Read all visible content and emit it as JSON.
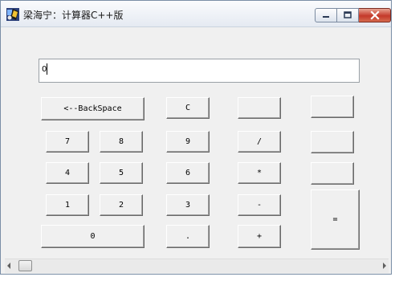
{
  "window": {
    "title": "梁海宁：计算器C++版",
    "title_icon": "calculator-app-icon",
    "controls": {
      "minimize_icon": "minimize-icon",
      "maximize_icon": "maximize-icon",
      "close_icon": "close-icon"
    }
  },
  "display": {
    "value": "0"
  },
  "buttons": {
    "backspace": "<--BackSpace",
    "clear": "C",
    "blank_row1_col4": "",
    "blank_row1_col5": "",
    "n7": "7",
    "n8": "8",
    "n9": "9",
    "divide": "/",
    "blank_row2_col5": "",
    "n4": "4",
    "n5": "5",
    "n6": "6",
    "multiply": "*",
    "blank_row3_col5": "",
    "n1": "1",
    "n2": "2",
    "n3": "3",
    "subtract": "-",
    "equals": "=",
    "n0": "0",
    "decimal": ".",
    "add": "+"
  },
  "scrollbar": {
    "left_icon": "scroll-left-icon",
    "right_icon": "scroll-right-icon"
  },
  "colors": {
    "close_button": "#c4392a",
    "window_bg": "#f0f0f0",
    "title_bar": "#e5eaf2"
  }
}
